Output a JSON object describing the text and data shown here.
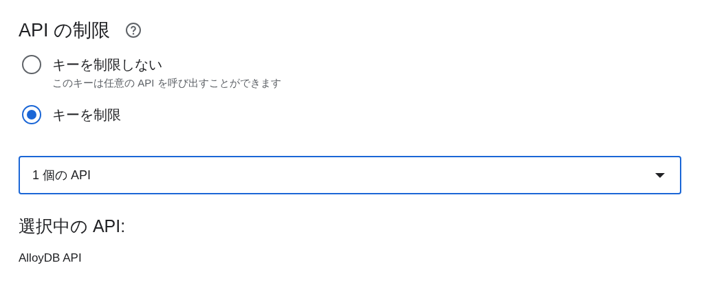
{
  "section": {
    "title": "API の制限"
  },
  "options": [
    {
      "label": "キーを制限しない",
      "description": "このキーは任意の API を呼び出すことができます",
      "selected": false
    },
    {
      "label": "キーを制限",
      "selected": true
    }
  ],
  "api_select": {
    "value": "1 個の API"
  },
  "selected_apis": {
    "heading": "選択中の API:",
    "items": [
      "AlloyDB API"
    ]
  }
}
